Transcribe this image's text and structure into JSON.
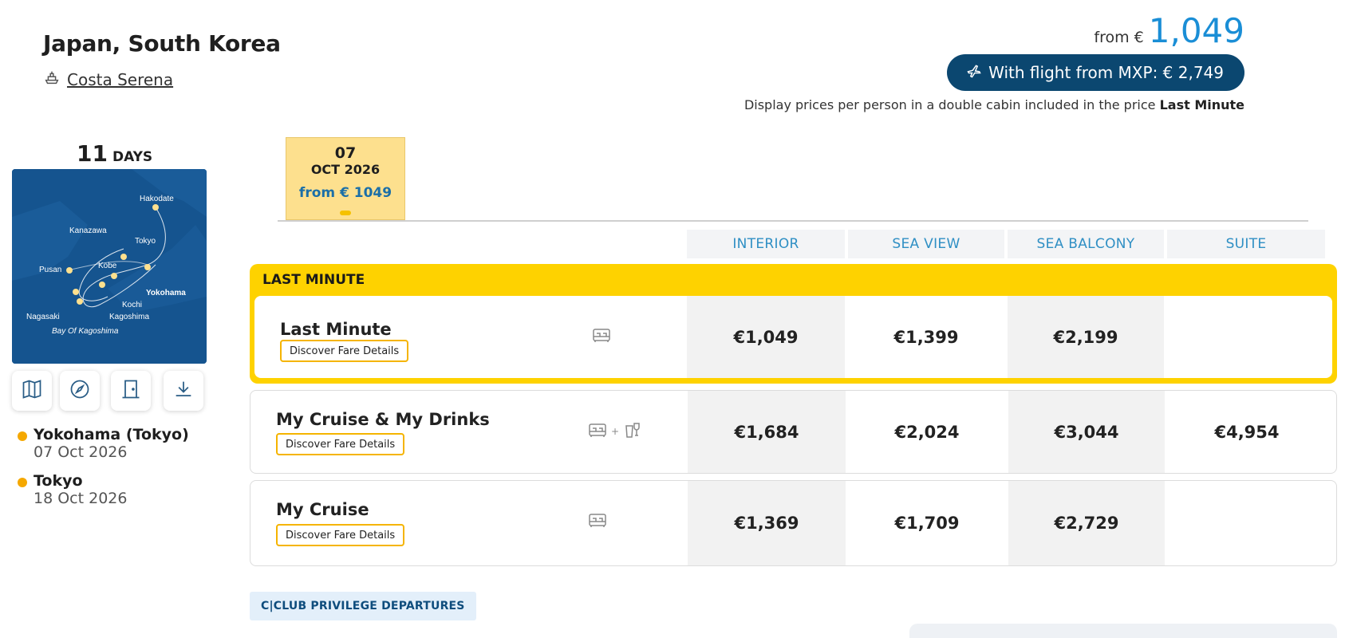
{
  "header": {
    "title": "Japan, South Korea",
    "ship_name": "Costa Serena",
    "from_label": "from €",
    "from_amount": "1,049",
    "flight_button": "With flight from MXP: € 2,749",
    "disclaimer_prefix": "Display prices per person in a double cabin included in the price ",
    "disclaimer_bold": "Last Minute"
  },
  "duration": {
    "number": "11",
    "label": "DAYS"
  },
  "map": {
    "labels": [
      "Hakodate",
      "Kanazawa",
      "Tokyo",
      "Pusan",
      "Kobe",
      "Yokohama",
      "Kochi",
      "Nagasaki",
      "Kagoshima",
      "Bay Of Kagoshima"
    ]
  },
  "tools": [
    "map-icon",
    "compass-icon",
    "door-icon",
    "download-icon"
  ],
  "itinerary": [
    {
      "port": "Yokohama (Tokyo)",
      "date": "07 Oct 2026"
    },
    {
      "port": "Tokyo",
      "date": "18 Oct 2026"
    }
  ],
  "date_tab": {
    "day": "07",
    "month": "OCT 2026",
    "from": "from € 1049"
  },
  "cabins": [
    "INTERIOR",
    "SEA VIEW",
    "SEA BALCONY",
    "SUITE"
  ],
  "last_minute_label": "LAST MINUTE",
  "fares": [
    {
      "name": "Last Minute",
      "details": "Discover Fare Details",
      "icons": [
        "bed-icon"
      ],
      "prices": [
        "€1,049",
        "€1,399",
        "€2,199",
        ""
      ]
    },
    {
      "name": "My Cruise & My Drinks",
      "details": "Discover Fare Details",
      "icons": [
        "bed-icon",
        "drinks-icon"
      ],
      "plus": "+",
      "prices": [
        "€1,684",
        "€2,024",
        "€3,044",
        "€4,954"
      ]
    },
    {
      "name": "My Cruise",
      "details": "Discover Fare Details",
      "icons": [
        "bed-icon"
      ],
      "prices": [
        "€1,369",
        "€1,709",
        "€2,729",
        ""
      ]
    }
  ],
  "cclub": "C|CLUB PRIVILEGE DEPARTURES",
  "colors": {
    "accent_blue": "#1a8ed6",
    "navy": "#0b4770",
    "last_minute_yellow": "#fed200",
    "date_tab": "#fde08e",
    "dot_orange": "#f5a800"
  }
}
